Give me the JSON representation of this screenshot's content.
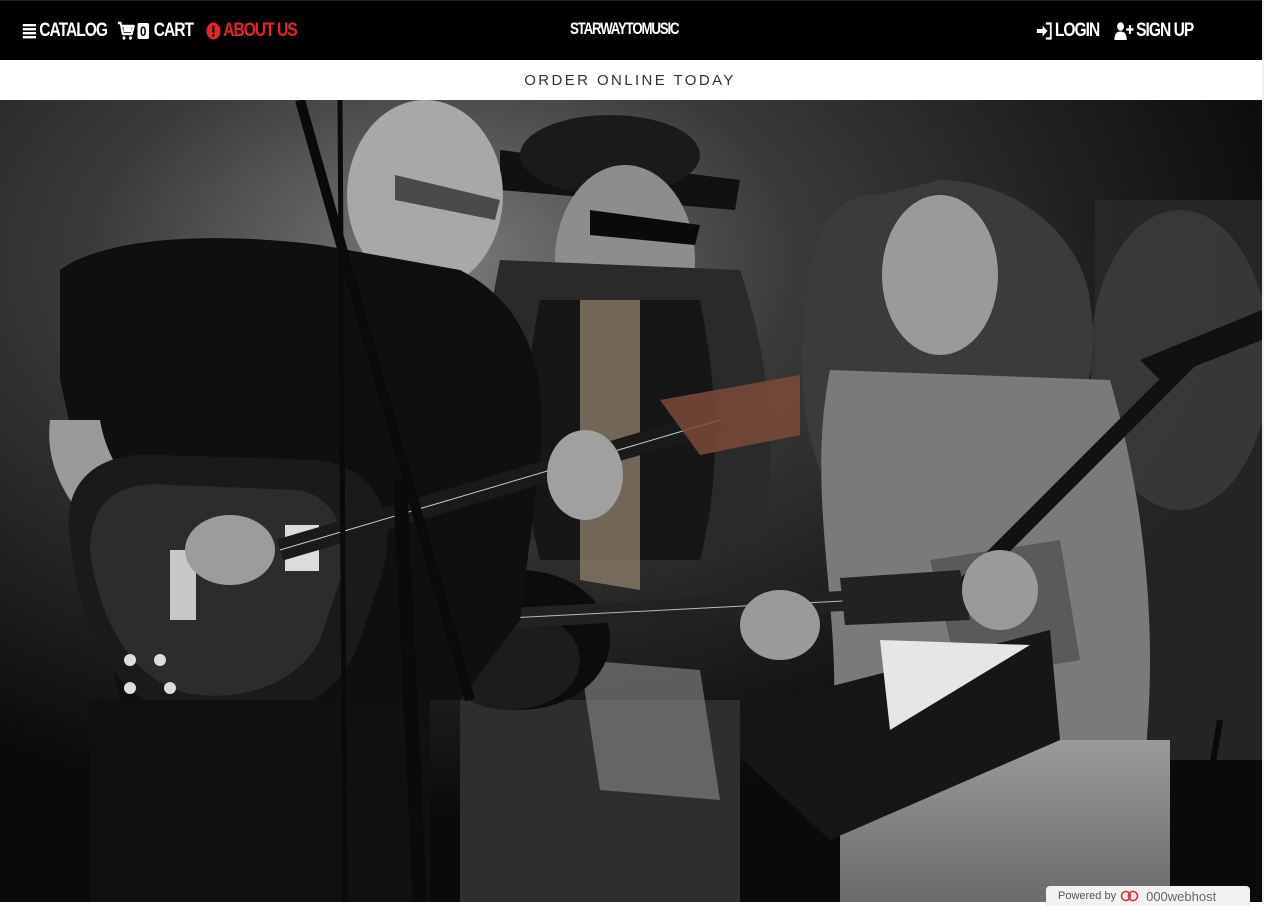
{
  "nav": {
    "catalog": {
      "label": "CATALOG",
      "icon": "menu-icon"
    },
    "cart": {
      "label": "CART",
      "count": "0",
      "icon": "cart-icon"
    },
    "about": {
      "label": "ABOUT US",
      "icon": "info-circle-icon",
      "color": "#e3262b"
    },
    "brand": "STARWAYTOMUSIC",
    "login": {
      "label": "LOGIN",
      "icon": "login-icon"
    },
    "signup": {
      "label": "SIGN UP",
      "icon": "user-plus-icon"
    }
  },
  "subbar": {
    "text": "ORDER ONLINE TODAY"
  },
  "hero": {
    "image": "black-and-white-photo-three-guitarists-on-stage"
  },
  "footer_badge": {
    "text": "Powered by",
    "brand": "000webhost"
  },
  "colors": {
    "topbar": "#000000",
    "accent": "#e3262b",
    "text_light": "#ffffff"
  }
}
